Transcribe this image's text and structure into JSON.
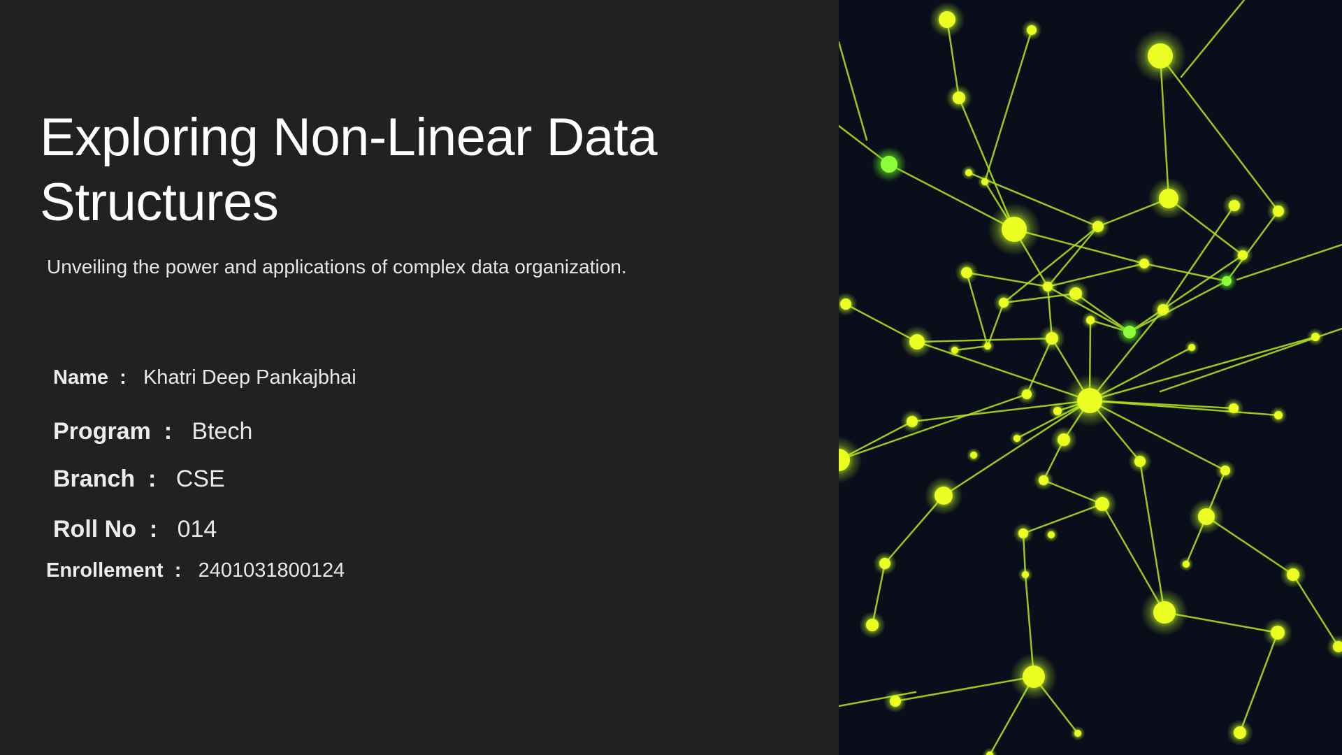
{
  "slide": {
    "title": "Exploring Non-Linear Data Structures",
    "subtitle": "Unveiling the power and applications of complex data organization.",
    "details": {
      "name": {
        "label": "Name",
        "separator": ":",
        "value": "Khatri Deep Pankajbhai"
      },
      "program": {
        "label": "Program",
        "separator": ":",
        "value": "Btech"
      },
      "branch": {
        "label": "Branch",
        "separator": ":",
        "value": "CSE"
      },
      "roll_no": {
        "label": "Roll No",
        "separator": ":",
        "value": "014"
      },
      "enrollment": {
        "label": "Enrollement",
        "separator": ":",
        "value": "2401031800124"
      }
    }
  },
  "image": {
    "icon": "glowing-network-graph-image",
    "colors": {
      "background": "#0a0e1a",
      "node": "#e8ff1a",
      "node_glow": "#b8ff2a",
      "edge": "#b6e61c"
    }
  }
}
